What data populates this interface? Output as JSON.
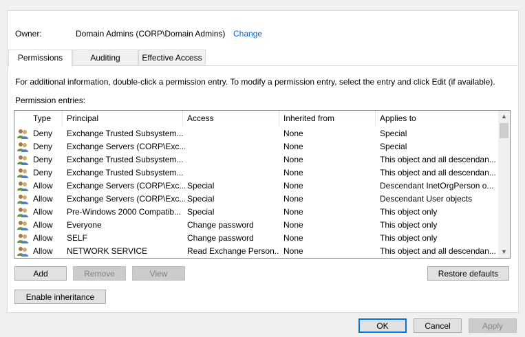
{
  "owner": {
    "label": "Owner:",
    "value": "Domain Admins (CORP\\Domain Admins)",
    "change_link": "Change"
  },
  "tabs": [
    {
      "label": "Permissions",
      "active": true
    },
    {
      "label": "Auditing",
      "active": false
    },
    {
      "label": "Effective Access",
      "active": false
    }
  ],
  "info_text": "For additional information, double-click a permission entry. To modify a permission entry, select the entry and click Edit (if available).",
  "entries_label": "Permission entries:",
  "columns": {
    "type": "Type",
    "principal": "Principal",
    "access": "Access",
    "inherited": "Inherited from",
    "applies": "Applies to"
  },
  "entries": [
    {
      "type": "Deny",
      "principal": "Exchange Trusted Subsystem...",
      "access": "",
      "inherited": "None",
      "applies": "Special"
    },
    {
      "type": "Deny",
      "principal": "Exchange Servers (CORP\\Exc...",
      "access": "",
      "inherited": "None",
      "applies": "Special"
    },
    {
      "type": "Deny",
      "principal": "Exchange Trusted Subsystem...",
      "access": "",
      "inherited": "None",
      "applies": "This object and all descendan..."
    },
    {
      "type": "Deny",
      "principal": "Exchange Trusted Subsystem...",
      "access": "",
      "inherited": "None",
      "applies": "This object and all descendan..."
    },
    {
      "type": "Allow",
      "principal": "Exchange Servers (CORP\\Exc...",
      "access": "Special",
      "inherited": "None",
      "applies": "Descendant InetOrgPerson o..."
    },
    {
      "type": "Allow",
      "principal": "Exchange Servers (CORP\\Exc...",
      "access": "Special",
      "inherited": "None",
      "applies": "Descendant User objects"
    },
    {
      "type": "Allow",
      "principal": "Pre-Windows 2000 Compatib...",
      "access": "Special",
      "inherited": "None",
      "applies": "This object only"
    },
    {
      "type": "Allow",
      "principal": "Everyone",
      "access": "Change password",
      "inherited": "None",
      "applies": "This object only"
    },
    {
      "type": "Allow",
      "principal": "SELF",
      "access": "Change password",
      "inherited": "None",
      "applies": "This object only"
    },
    {
      "type": "Allow",
      "principal": "NETWORK SERVICE",
      "access": "Read Exchange Person...",
      "inherited": "None",
      "applies": "This object and all descendan..."
    }
  ],
  "entry_icon": "users-group-icon",
  "buttons": {
    "add": "Add",
    "remove": "Remove",
    "view": "View",
    "restore_defaults": "Restore defaults",
    "enable_inheritance": "Enable inheritance",
    "ok": "OK",
    "cancel": "Cancel",
    "apply": "Apply"
  },
  "scroll": {
    "up_glyph": "▲",
    "down_glyph": "▼"
  },
  "colors": {
    "link": "#0066cc",
    "default_button_border": "#0078d7"
  }
}
